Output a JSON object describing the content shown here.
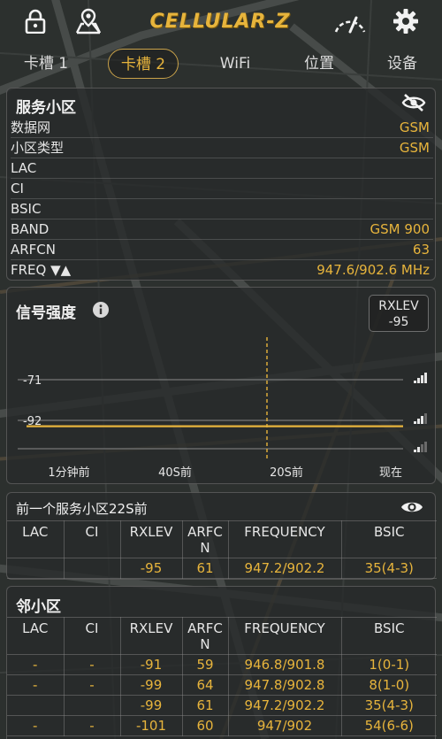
{
  "app": {
    "title": "CELLULAR-Z"
  },
  "icons": {
    "lock": "lock-icon",
    "map_pin": "map-pin-icon",
    "gauge": "speedometer-icon",
    "settings": "gear-icon",
    "hide": "eye-off-icon",
    "show": "eye-icon",
    "info": "info-icon",
    "signal": "signal-bars-icon"
  },
  "colors": {
    "accent": "#e7b43c",
    "text": "#e6e6e6"
  },
  "tabs": [
    {
      "label": "卡槽 1",
      "active": false
    },
    {
      "label": "卡槽 2",
      "active": true
    },
    {
      "label": "WiFi",
      "active": false
    },
    {
      "label": "位置",
      "active": false
    },
    {
      "label": "设备",
      "active": false
    }
  ],
  "serving_cell": {
    "title": "服务小区",
    "rows": [
      {
        "key": "数据网",
        "value": "GSM"
      },
      {
        "key": "小区类型",
        "value": "GSM"
      },
      {
        "key": "LAC",
        "value": ""
      },
      {
        "key": "CI",
        "value": ""
      },
      {
        "key": "BSIC",
        "value": ""
      },
      {
        "key": "BAND",
        "value": "GSM 900"
      },
      {
        "key": "ARFCN",
        "value": "63"
      },
      {
        "key": "FREQ ▼▲",
        "value": "947.6/902.6 MHz"
      }
    ]
  },
  "signal": {
    "title": "信号强度",
    "badge_label": "RXLEV",
    "badge_value": "-95"
  },
  "chart_data": {
    "type": "line",
    "title": "信号强度",
    "x_tick_labels": [
      "1分钟前",
      "40S前",
      "20S前",
      "现在"
    ],
    "y_tick_labels": [
      "-71",
      "-92"
    ],
    "y_ticks": [
      -71,
      -92
    ],
    "series": [
      {
        "values": [
          -95,
          -95,
          -95,
          -95,
          -95,
          -95,
          -95,
          -95,
          -95,
          -95,
          -95,
          -95,
          -95,
          -95,
          -95,
          -95,
          -95,
          -95,
          -95,
          -95,
          -95,
          -95,
          -95,
          -95,
          -95,
          -95,
          -95,
          -95,
          -95,
          -95,
          -95,
          -95,
          -95,
          -95,
          -95,
          -95,
          -95,
          -95,
          -95,
          -95,
          -95,
          -95,
          -95,
          -95,
          -95,
          -95,
          -95,
          -95,
          -95,
          -95,
          -95,
          -95,
          -95,
          -95,
          -95,
          -95,
          -95,
          -95,
          -95,
          -95
        ],
        "color": "#e7b43c"
      }
    ],
    "ylim": [
      -110,
      -60
    ],
    "marker_label": "20S前",
    "grid": true
  },
  "previous_cell": {
    "title": "前一个服务小区22S前",
    "headers": [
      "LAC",
      "CI",
      "RXLEV",
      "ARFCN",
      "FREQUENCY",
      "BSIC"
    ],
    "rows": [
      [
        "",
        "",
        "-95",
        "61",
        "947.2/902.2",
        "35(4-3)"
      ]
    ]
  },
  "neighbors": {
    "title": "邻小区",
    "headers": [
      "LAC",
      "CI",
      "RXLEV",
      "ARFCN",
      "FREQUENCY",
      "BSIC"
    ],
    "rows": [
      [
        "-",
        "-",
        "-91",
        "59",
        "946.8/901.8",
        "1(0-1)"
      ],
      [
        "-",
        "-",
        "-99",
        "64",
        "947.8/902.8",
        "8(1-0)"
      ],
      [
        "",
        "",
        "-99",
        "61",
        "947.2/902.2",
        "35(4-3)"
      ],
      [
        "-",
        "-",
        "-101",
        "60",
        "947/902",
        "54(6-6)"
      ]
    ]
  }
}
